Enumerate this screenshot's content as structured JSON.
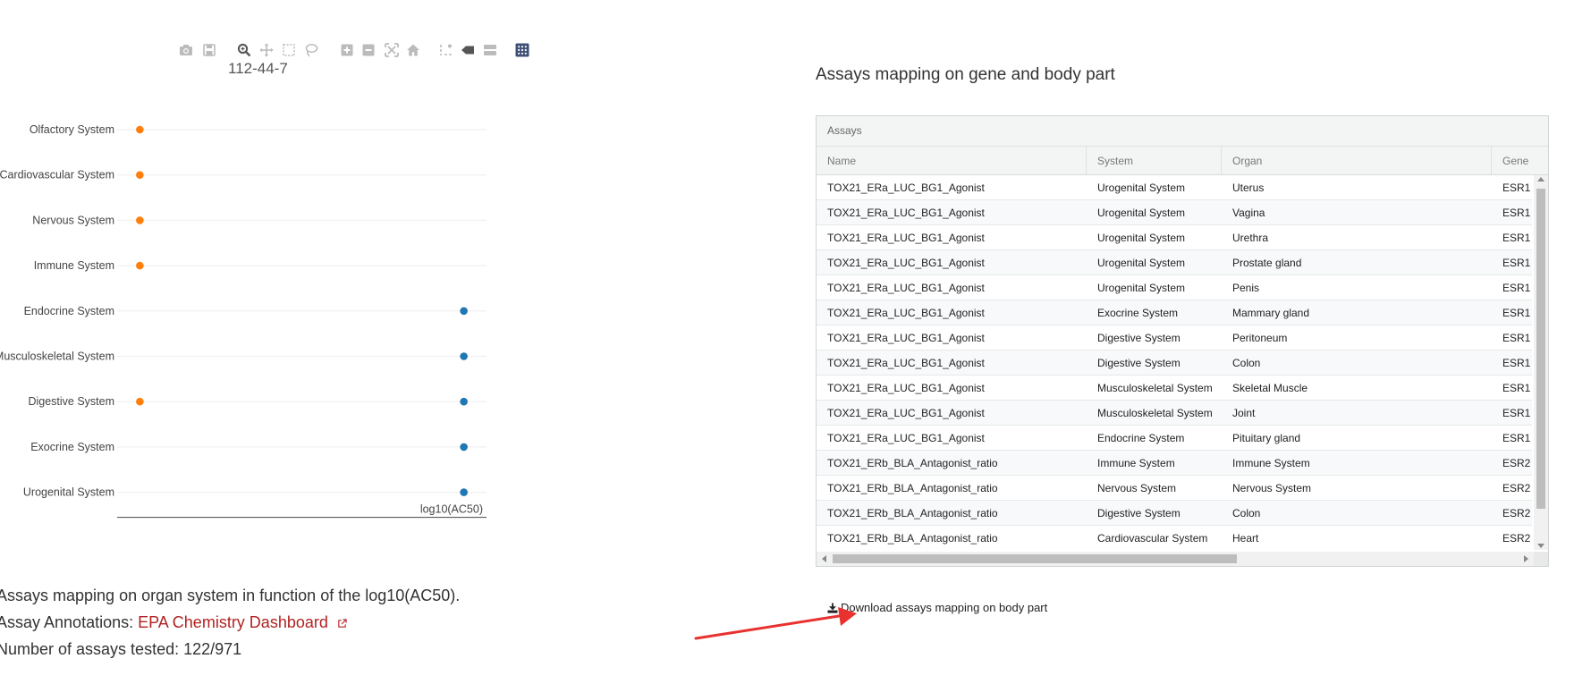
{
  "modebar": {
    "icons": [
      "camera-icon",
      "save-icon",
      "zoom-icon",
      "pan-icon",
      "box-select-icon",
      "lasso-icon",
      "zoom-in-icon",
      "zoom-out-icon",
      "autoscale-icon",
      "reset-axes-icon",
      "spike-lines-icon",
      "hover-closest-icon",
      "hover-compare-icon",
      "plotly-logo-icon"
    ]
  },
  "chart": {
    "title": "112-44-7",
    "xlabel": "log10(AC50)"
  },
  "chart_data": {
    "type": "scatter",
    "title": "112-44-7",
    "xlabel": "log10(AC50)",
    "ylabel": "",
    "categories": [
      "Olfactory System",
      "Cardiovascular System",
      "Nervous System",
      "Immune System",
      "Endocrine System",
      "Musculoskeletal System",
      "Digestive System",
      "Exocrine System",
      "Urogenital System"
    ],
    "series": [
      {
        "color": "#ff7f0e",
        "points": [
          {
            "x": 0,
            "y": "Olfactory System"
          },
          {
            "x": 0,
            "y": "Cardiovascular System"
          },
          {
            "x": 0,
            "y": "Nervous System"
          },
          {
            "x": 0,
            "y": "Immune System"
          },
          {
            "x": 0,
            "y": "Digestive System"
          }
        ]
      },
      {
        "color": "#1f77b4",
        "points": [
          {
            "x": 1,
            "y": "Endocrine System"
          },
          {
            "x": 1,
            "y": "Musculoskeletal System"
          },
          {
            "x": 1,
            "y": "Digestive System"
          },
          {
            "x": 1,
            "y": "Exocrine System"
          },
          {
            "x": 1,
            "y": "Urogenital System"
          }
        ]
      }
    ],
    "xlim": [
      -0.07,
      1.07
    ],
    "grid": true,
    "legend": "none"
  },
  "caption": "Assays mapping on organ system in function of the log10(AC50).",
  "annotations": {
    "prefix": "Assay Annotations: ",
    "link_text": "EPA Chemistry Dashboard",
    "link_icon": "external-link-icon"
  },
  "tested": "Number of assays tested: 122/971",
  "right": {
    "title": "Assays mapping on gene and body part",
    "panel_title": "Assays",
    "columns": [
      "Name",
      "System",
      "Organ",
      "Gene"
    ],
    "rows": [
      [
        "TOX21_ERa_LUC_BG1_Agonist",
        "Urogenital System",
        "Uterus",
        "ESR1"
      ],
      [
        "TOX21_ERa_LUC_BG1_Agonist",
        "Urogenital System",
        "Vagina",
        "ESR1"
      ],
      [
        "TOX21_ERa_LUC_BG1_Agonist",
        "Urogenital System",
        "Urethra",
        "ESR1"
      ],
      [
        "TOX21_ERa_LUC_BG1_Agonist",
        "Urogenital System",
        "Prostate gland",
        "ESR1"
      ],
      [
        "TOX21_ERa_LUC_BG1_Agonist",
        "Urogenital System",
        "Penis",
        "ESR1"
      ],
      [
        "TOX21_ERa_LUC_BG1_Agonist",
        "Exocrine System",
        "Mammary gland",
        "ESR1"
      ],
      [
        "TOX21_ERa_LUC_BG1_Agonist",
        "Digestive System",
        "Peritoneum",
        "ESR1"
      ],
      [
        "TOX21_ERa_LUC_BG1_Agonist",
        "Digestive System",
        "Colon",
        "ESR1"
      ],
      [
        "TOX21_ERa_LUC_BG1_Agonist",
        "Musculoskeletal System",
        "Skeletal Muscle",
        "ESR1"
      ],
      [
        "TOX21_ERa_LUC_BG1_Agonist",
        "Musculoskeletal System",
        "Joint",
        "ESR1"
      ],
      [
        "TOX21_ERa_LUC_BG1_Agonist",
        "Endocrine System",
        "Pituitary gland",
        "ESR1"
      ],
      [
        "TOX21_ERb_BLA_Antagonist_ratio",
        "Immune System",
        "Immune System",
        "ESR2"
      ],
      [
        "TOX21_ERb_BLA_Antagonist_ratio",
        "Nervous System",
        "Nervous System",
        "ESR2"
      ],
      [
        "TOX21_ERb_BLA_Antagonist_ratio",
        "Digestive System",
        "Colon",
        "ESR2"
      ],
      [
        "TOX21_ERb_BLA_Antagonist_ratio",
        "Cardiovascular System",
        "Heart",
        "ESR2"
      ]
    ],
    "download_label": "Download assays mapping on body part",
    "download_icon": "download-icon"
  },
  "colors": {
    "orange_series": "#ff7f0e",
    "blue_series": "#1f77b4",
    "link": "#b22222",
    "annotation_arrow": "#e8322f"
  }
}
